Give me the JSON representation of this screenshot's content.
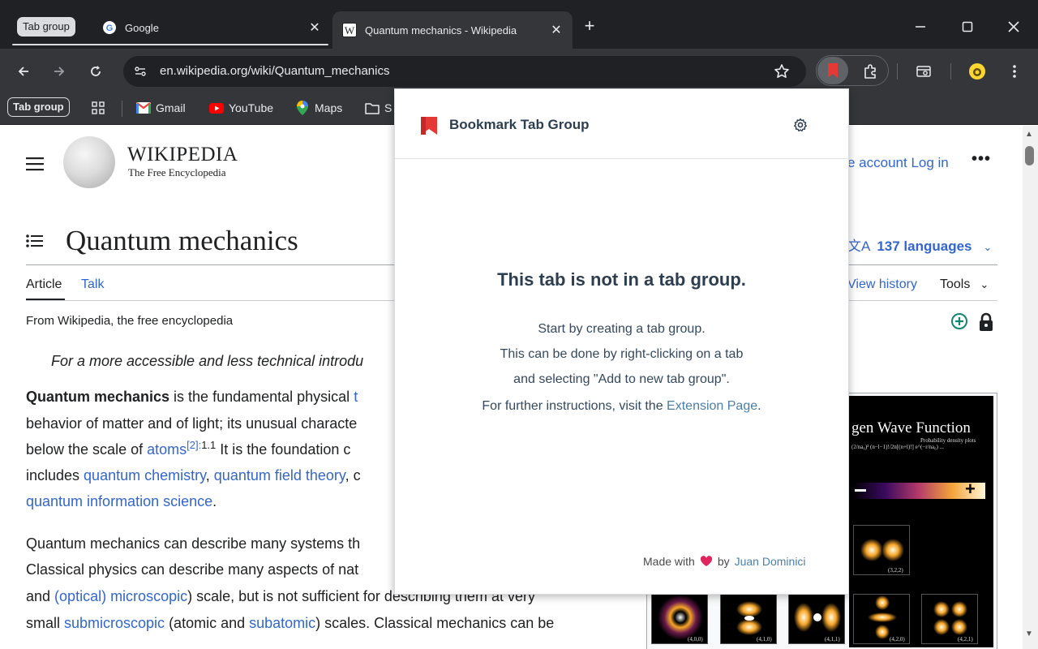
{
  "browser": {
    "tab_group_chip": "Tab group",
    "tabs": [
      {
        "title": "Google"
      },
      {
        "title": "Quantum mechanics - Wikipedia"
      }
    ],
    "url": "en.wikipedia.org/wiki/Quantum_mechanics",
    "bookmarks_bar": {
      "tab_group_chip": "Tab group",
      "items": [
        "Gmail",
        "YouTube",
        "Maps",
        "S"
      ]
    }
  },
  "wikipedia": {
    "wordmark": "WIKIPEDIA",
    "tagline": "The Free Encyclopedia",
    "header_links": "e account  Log in",
    "more": "•••",
    "page_title": "Quantum mechanics",
    "languages": "137 languages",
    "tabs": {
      "article": "Article",
      "talk": "Talk",
      "view_history": "View history",
      "tools": "Tools"
    },
    "from": "From Wikipedia, the free encyclopedia",
    "hatnote": "For a more accessible and less technical introdu",
    "paragraph1": {
      "l1_bold": "Quantum mechanics",
      "l1_text": " is the fundamental physical ",
      "l1_link": "t",
      "l2": "behavior of matter and of light; its unusual characte",
      "l3_text": "below the scale of ",
      "l3_link": "atoms",
      "l3_sup": "[2]:",
      "l3_sup2": "1.1",
      "l3_rest": " It is the foundation c",
      "l4_text": "includes ",
      "l4_link1": "quantum chemistry",
      "l4_sep": ", ",
      "l4_link2": "quantum field theory",
      "l4_rest": ", c",
      "l5_link": "quantum information science",
      "l5_rest": "."
    },
    "paragraph2": {
      "l1": "Quantum mechanics can describe many systems th",
      "l2": "Classical physics can describe many aspects of nat",
      "l3_text1": "and ",
      "l3_link": "(optical) microscopic",
      "l3_text2": ") scale, but is not sufficient for describing them at very",
      "l4_text1": "small ",
      "l4_link1": "submicroscopic",
      "l4_text2": " (atomic and ",
      "l4_link2": "subatomic",
      "l4_text3": ") scales. Classical mechanics can be"
    },
    "infobox": {
      "title": "gen Wave Function",
      "subtitle": "Probability density plots",
      "formula": "(2/na₀)³ (n−l−1)!/2n[(n+l)!] e^(−r/na₀) ...",
      "orbital_labels": [
        "(3,2,2)",
        "(4,0,0)",
        "(4,1,0)",
        "(4,1,1)",
        "(4,2,0)",
        "(4,2,1)"
      ]
    }
  },
  "popup": {
    "title": "Bookmark Tab Group",
    "heading": "This tab is not in a tab group.",
    "lines": [
      "Start by creating a tab group.",
      "This can be done by right-clicking on a tab",
      "and selecting \"Add to new tab group\"."
    ],
    "instructions_text": "For further instructions, visit the ",
    "instructions_link": "Extension Page",
    "instructions_end": ".",
    "footer_text1": "Made with",
    "footer_text2": "by",
    "footer_author": "Juan Dominici"
  },
  "colors": {
    "chrome_dark": "#202124",
    "chrome_toolbar": "#35363a",
    "wiki_link": "#3366cc",
    "popup_accent": "#e53935",
    "popup_link": "#4a7fa8"
  }
}
